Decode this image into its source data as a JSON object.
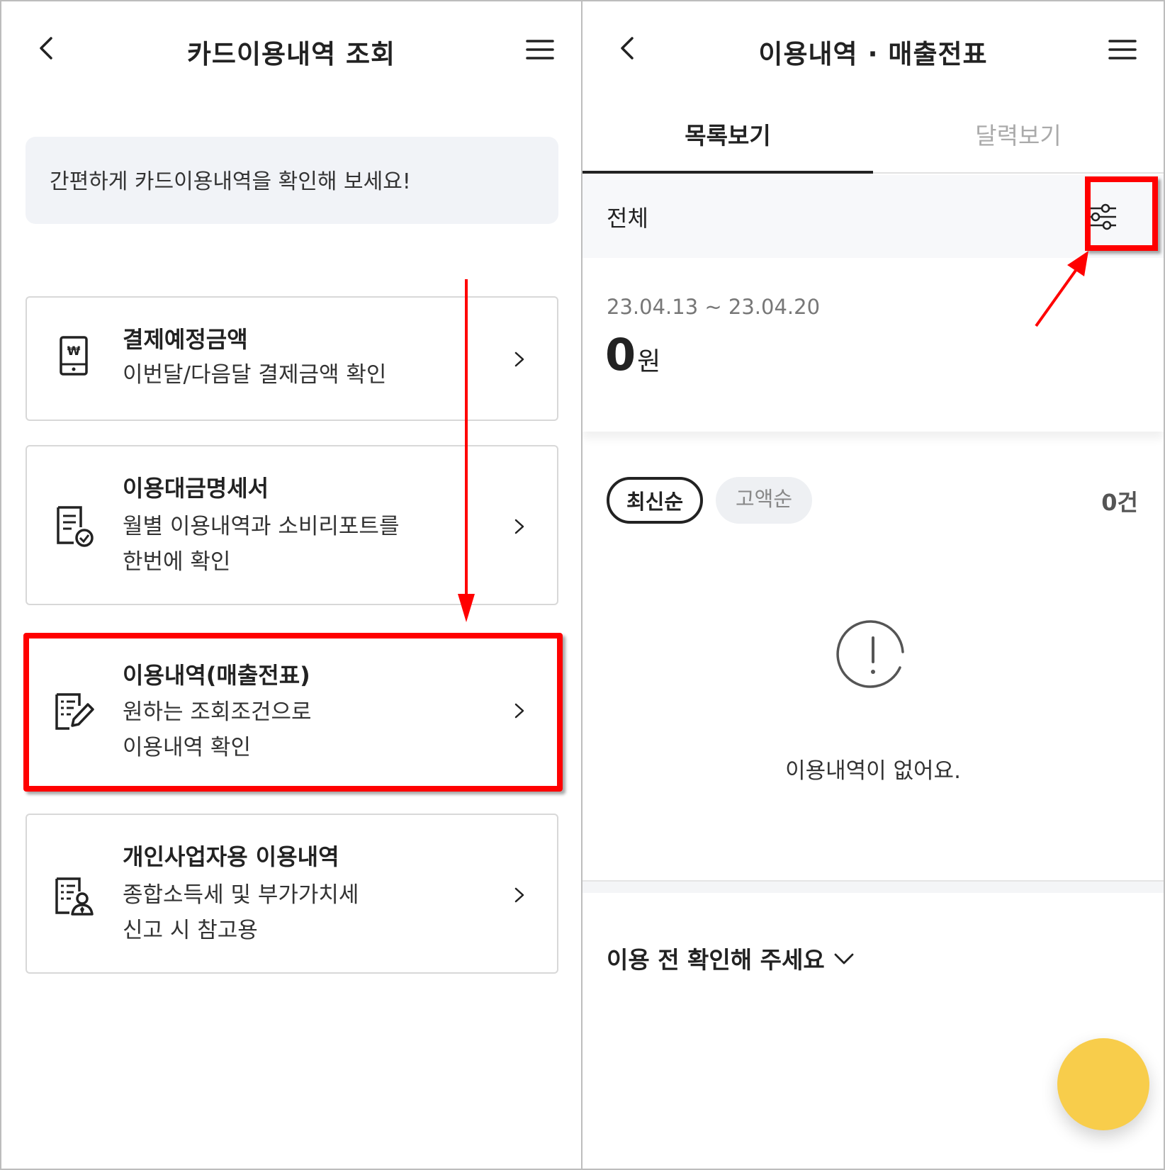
{
  "left": {
    "title": "카드이용내역 조회",
    "notice": "간편하게 카드이용내역을 확인해 보세요!",
    "cards": [
      {
        "title": "결제예정금액",
        "desc1": "이번달/다음달 결제금액 확인",
        "desc2": ""
      },
      {
        "title": "이용대금명세서",
        "desc1": "월별 이용내역과 소비리포트를",
        "desc2": "한번에 확인"
      },
      {
        "title": "이용내역(매출전표)",
        "desc1": "원하는 조회조건으로",
        "desc2": "이용내역 확인"
      },
      {
        "title": "개인사업자용 이용내역",
        "desc1": "종합소득세 및 부가가치세",
        "desc2": "신고 시 참고용"
      }
    ]
  },
  "right": {
    "title": "이용내역 · 매출전표",
    "tabs": [
      {
        "label": "목록보기",
        "active": true
      },
      {
        "label": "달력보기",
        "active": false
      }
    ],
    "filter_label": "전체",
    "period": "23.04.13 ~ 23.04.20",
    "amount": "0",
    "amount_unit": "원",
    "sort_chips": [
      "최신순",
      "고액순"
    ],
    "count": "0건",
    "empty_text": "이용내역이 없어요.",
    "check_title": "이용 전 확인해 주세요"
  },
  "colors": {
    "highlight": "#ff0000",
    "fab": "#f8cd4b",
    "notice_bg": "#f1f3f7"
  },
  "icons": [
    "back-icon",
    "menu-icon",
    "won-phone-icon",
    "statement-check-icon",
    "edit-document-icon",
    "business-person-icon",
    "chevron-right-icon",
    "filter-sliders-icon",
    "exclamation-circle-icon",
    "chevron-down-icon"
  ]
}
